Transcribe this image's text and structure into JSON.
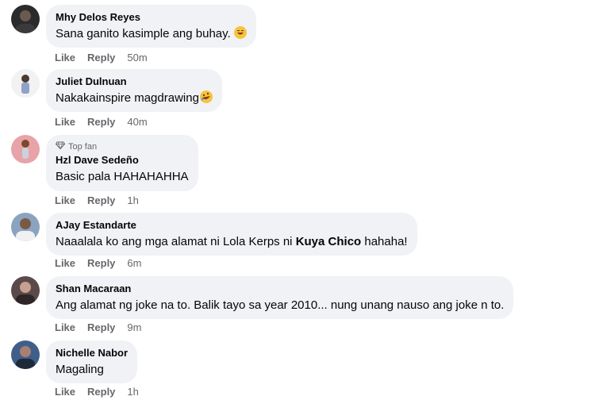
{
  "comments": [
    {
      "author": "Mhy Delos Reyes",
      "text": "Sana ganito kasimple ang buhay.",
      "emoji": "laughing-emoji",
      "time": "50m",
      "like": "Like",
      "reply": "Reply"
    },
    {
      "author": "Juliet Dulnuan",
      "text": "Nakakainspire magdrawing",
      "emoji": "rolling-laughing-emoji",
      "time": "40m",
      "like": "Like",
      "reply": "Reply"
    },
    {
      "author": "Hzl Dave Sedeño",
      "badge": "Top fan",
      "text": "Basic pala HAHAHAHHA",
      "time": "1h",
      "like": "Like",
      "reply": "Reply"
    },
    {
      "author": "AJay Estandarte",
      "text_before": "Naaalala ko ang mga alamat ni Lola Kerps ni ",
      "text_bold": "Kuya Chico",
      "text_after": " hahaha!",
      "time": "6m",
      "like": "Like",
      "reply": "Reply"
    },
    {
      "author": "Shan Macaraan",
      "text": "Ang alamat ng joke na to. Balik tayo sa year 2010... nung unang nauso ang joke n to.",
      "time": "9m",
      "like": "Like",
      "reply": "Reply"
    },
    {
      "author": "Nichelle Nabor",
      "text": "Magaling",
      "time": "1h",
      "like": "Like",
      "reply": "Reply"
    }
  ],
  "colors": {
    "bubble": "#f0f2f5",
    "meta": "#65676b",
    "text": "#050505"
  }
}
